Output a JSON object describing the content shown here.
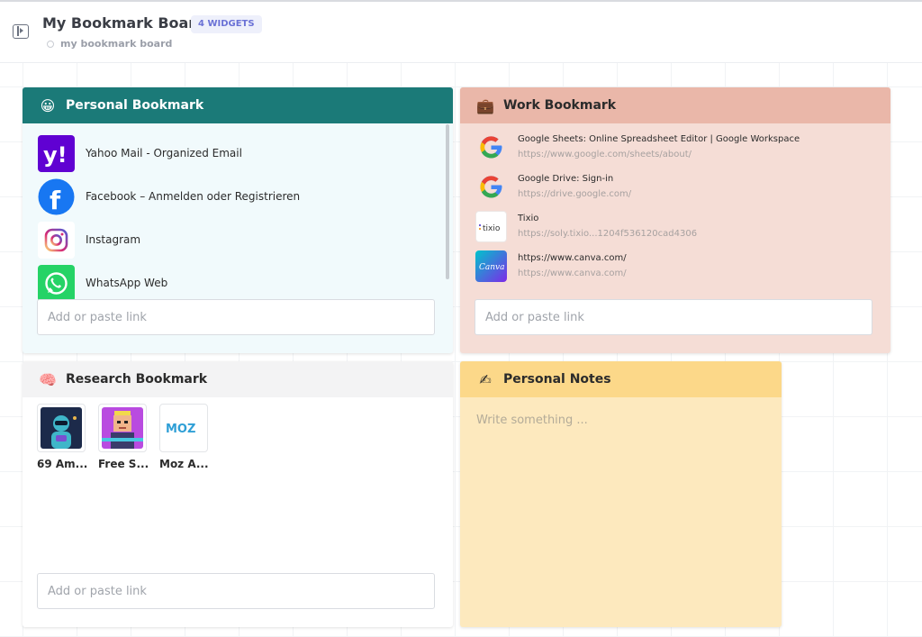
{
  "header": {
    "title": "My Bookmark Board",
    "badge": "4 WIDGETS",
    "subtitle": "my bookmark board"
  },
  "widgets": {
    "personal": {
      "title": "Personal Bookmark",
      "icon": "smiley-face-icon",
      "items": [
        {
          "label": "Yahoo Mail - Organized Email",
          "icon": "yahoo-logo-icon"
        },
        {
          "label": "Facebook – Anmelden oder Registrieren",
          "icon": "facebook-logo-icon"
        },
        {
          "label": "Instagram",
          "icon": "instagram-logo-icon"
        },
        {
          "label": "WhatsApp Web",
          "icon": "whatsapp-logo-icon"
        }
      ],
      "input_placeholder": "Add or paste link",
      "colors": {
        "header": "#1b7a78",
        "body": "#f1fafc"
      }
    },
    "work": {
      "title": "Work Bookmark",
      "icon": "briefcase-icon",
      "items": [
        {
          "title": "Google Sheets: Online Spreadsheet Editor | Google Workspace",
          "url": "https://www.google.com/sheets/about/",
          "icon": "google-logo-icon"
        },
        {
          "title": "Google Drive: Sign-in",
          "url": "https://drive.google.com/",
          "icon": "google-logo-icon"
        },
        {
          "title": "Tixio",
          "url": "https://soly.tixio...1204f536120cad4306",
          "icon": "tixio-logo-icon"
        },
        {
          "title": "https://www.canva.com/",
          "url": "https://www.canva.com/",
          "icon": "canva-logo-icon"
        }
      ],
      "input_placeholder": "Add or paste link",
      "colors": {
        "header": "#eab7a9",
        "body": "#f5ddd6"
      }
    },
    "research": {
      "title": "Research Bookmark",
      "icon": "brain-icon",
      "items": [
        {
          "label": "69 Am...",
          "icon": "robot-avatar-icon"
        },
        {
          "label": "Free S...",
          "icon": "pixel-avatar-icon"
        },
        {
          "label": "Moz A...",
          "icon": "moz-logo-icon"
        }
      ],
      "input_placeholder": "Add or paste link",
      "colors": {
        "header": "#f3f3f4",
        "body": "#ffffff"
      }
    },
    "notes": {
      "title": "Personal Notes",
      "icon": "writing-hand-icon",
      "placeholder": "Write something ...",
      "colors": {
        "header": "#fcd889",
        "body": "#fde9be"
      }
    }
  }
}
